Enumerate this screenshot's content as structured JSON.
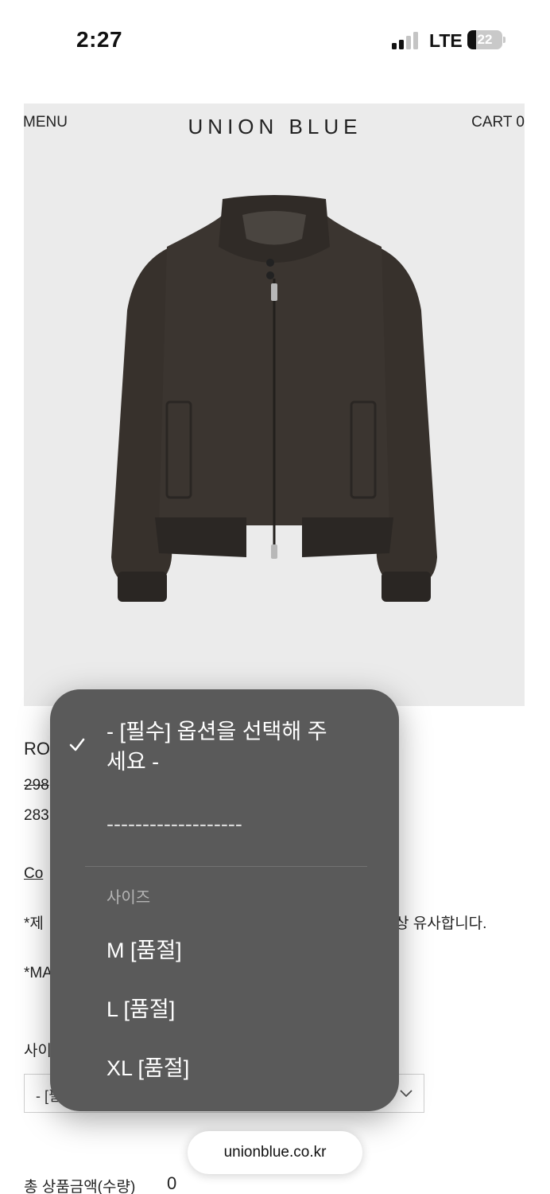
{
  "status_bar": {
    "time": "2:27",
    "network": "LTE",
    "battery": "22"
  },
  "header": {
    "menu_label": "MENU",
    "brand": "UNION BLUE",
    "cart_label": "CART 0"
  },
  "product": {
    "name_partial": "RO",
    "original_price_partial": "298",
    "price_partial": "283",
    "composition_link_partial": "Co",
    "note_partial_left": "*제",
    "note_partial_right": "상 유사합니다.",
    "material_partial": "*MA",
    "size_label_partial": "사이",
    "select_value_partial": "- [필"
  },
  "dropdown": {
    "selected_option": "- [필수] 옵션을 선택해 주세요 -",
    "separator_option": "-------------------",
    "group_label": "사이즈",
    "options": [
      "M [품절]",
      "L [품절]",
      "XL [품절]"
    ]
  },
  "browser": {
    "url": "unionblue.co.kr"
  },
  "total": {
    "label": "총 상품금액(수량)",
    "value": "0"
  },
  "colors": {
    "popover_bg": "#5a5a5a",
    "image_bg": "#ebebeb",
    "jacket": "#3b3530"
  }
}
